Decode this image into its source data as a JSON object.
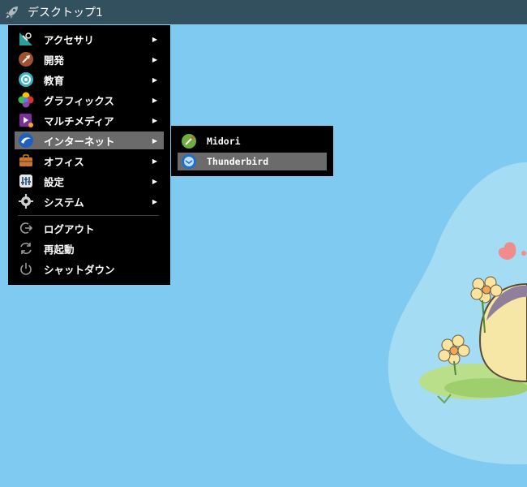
{
  "taskbar": {
    "launcher_icon": "rocket-icon",
    "desktop_label": "デスクトップ1"
  },
  "menu": {
    "items": [
      {
        "label": "アクセサリ",
        "icon": "accessories-icon",
        "submenu": true
      },
      {
        "label": "開発",
        "icon": "development-icon",
        "submenu": true
      },
      {
        "label": "教育",
        "icon": "education-icon",
        "submenu": true
      },
      {
        "label": "グラフィックス",
        "icon": "graphics-icon",
        "submenu": true
      },
      {
        "label": "マルチメディア",
        "icon": "multimedia-icon",
        "submenu": true
      },
      {
        "label": "インターネット",
        "icon": "internet-icon",
        "submenu": true,
        "active": true
      },
      {
        "label": "オフィス",
        "icon": "office-icon",
        "submenu": true
      },
      {
        "label": "設定",
        "icon": "settings-icon",
        "submenu": true
      },
      {
        "label": "システム",
        "icon": "system-icon",
        "submenu": true
      }
    ],
    "actions": [
      {
        "label": "ログアウト",
        "icon": "logout-icon"
      },
      {
        "label": "再起動",
        "icon": "restart-icon"
      },
      {
        "label": "シャットダウン",
        "icon": "shutdown-icon"
      }
    ],
    "arrow_glyph": "▶"
  },
  "submenu": {
    "items": [
      {
        "label": "Midori",
        "icon": "midori-icon"
      },
      {
        "label": "Thunderbird",
        "icon": "thunderbird-icon",
        "active": true
      }
    ]
  },
  "colors": {
    "taskbar": "#33505f",
    "desktop": "#7ecaf0",
    "menu_bg": "#000000",
    "highlight": "#6b6b6b"
  }
}
